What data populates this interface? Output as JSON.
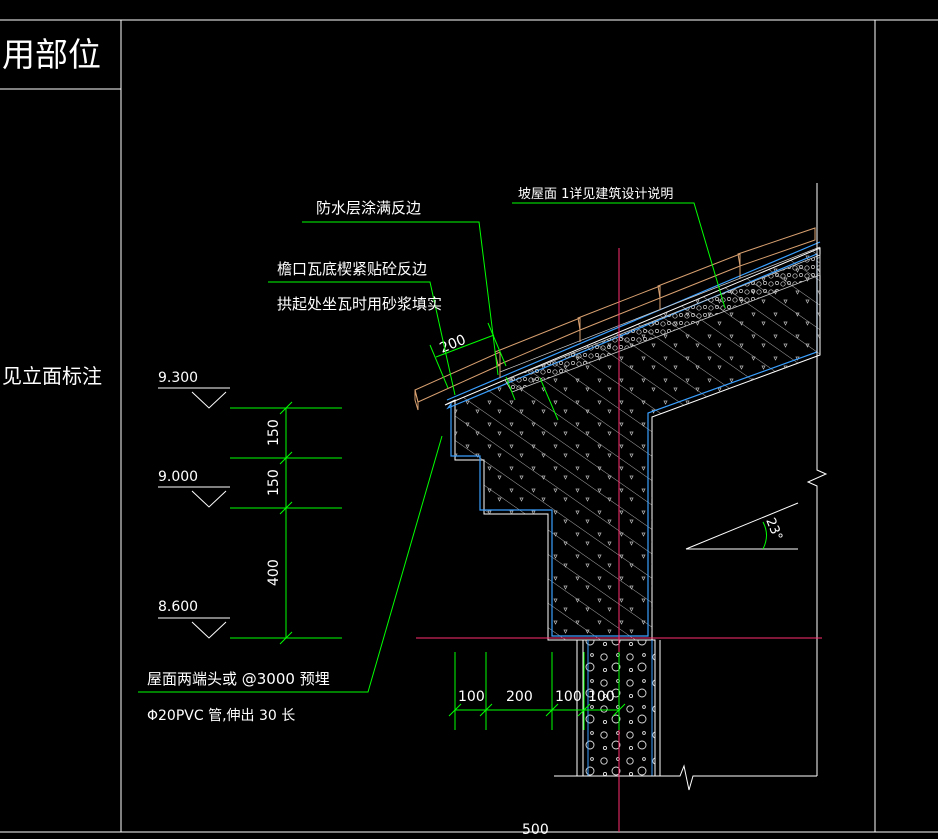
{
  "title_block": {
    "header_text": "用部位",
    "row_text": "见立面标注"
  },
  "callouts": {
    "waterproof": "防水层涂满反边",
    "roof_ref": "坡屋面 1详见建筑设计说明",
    "eave_tile_1": "檐口瓦底楔紧贴砼反边",
    "eave_tile_2": "拱起处坐瓦时用砂浆填实",
    "eave_dim": "200",
    "pipe_note_1": "屋面两端头或   @3000  预埋",
    "pipe_note_2": "Φ20PVC  管,伸出 30 长"
  },
  "elevations": {
    "top": "9.300",
    "mid": "9.000",
    "bottom": "8.600"
  },
  "vertical_dims": {
    "a": "150",
    "b": "150",
    "c": "400"
  },
  "horizontal_dims": {
    "a": "100",
    "b": "200",
    "c": "100",
    "d": "100"
  },
  "bottom_dim": "500",
  "slope_angle": "23°",
  "colors": {
    "background": "#000000",
    "frame": "#ffffff",
    "dimension": "#00ff00",
    "structure": "#ffffff",
    "outline": "#3aa0ff",
    "axis": "#ff2d6f",
    "tile": "#d8a070"
  }
}
